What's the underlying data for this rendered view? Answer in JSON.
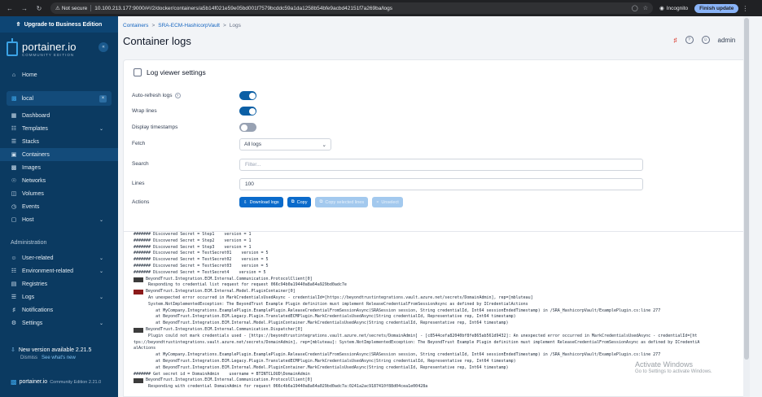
{
  "browser": {
    "security": "Not secure",
    "url": "10.100.213.177:9000/#!/2/docker/containers/a5b14f021e59e05bd001f7579bcddc59a1da1258b54bfe9acbd42151f7a269ba/logs",
    "incognito": "Incognito",
    "finish_update": "Finish update"
  },
  "sidebar": {
    "upgrade": "Upgrade to Business Edition",
    "logo_main": "portainer.io",
    "logo_sub": "COMMUNITY EDITION",
    "home": "Home",
    "env_name": "local",
    "env_items": [
      "Dashboard",
      "Templates",
      "Stacks",
      "Containers",
      "Images",
      "Networks",
      "Volumes",
      "Events",
      "Host"
    ],
    "admin_title": "Administration",
    "admin_items": [
      "User-related",
      "Environment-related",
      "Registries",
      "Logs",
      "Notifications",
      "Settings"
    ],
    "new_version": "New version available 2.21.5",
    "dismiss": "Dismiss",
    "see_whats_new": "See what's new",
    "footer_brand": "portainer.io",
    "footer_edition": "Community Edition 2.21.0"
  },
  "main": {
    "breadcrumb": [
      "Containers",
      "SRA-ECM-HashicorpVault",
      "Logs"
    ],
    "title": "Container logs",
    "user": "admin"
  },
  "settings": {
    "title": "Log viewer settings",
    "auto_refresh_label": "Auto-refresh logs",
    "wrap_lines_label": "Wrap lines",
    "display_timestamps_label": "Display timestamps",
    "fetch_label": "Fetch",
    "fetch_value": "All logs",
    "search_label": "Search",
    "search_placeholder": "Filter...",
    "lines_label": "Lines",
    "lines_value": "100",
    "actions_label": "Actions",
    "download_btn": "Download logs",
    "copy_btn": "Copy",
    "copy_selected_btn": "Copy selected lines",
    "unselect_btn": "Unselect"
  },
  "logs": [
    {
      "tag": "",
      "text": "####### Discovered Secret = Step1    version = 1"
    },
    {
      "tag": "",
      "text": "####### Discovered Secret = Step2    version = 1"
    },
    {
      "tag": "",
      "text": "####### Discovered Secret = Step3    version = 1"
    },
    {
      "tag": "",
      "text": "####### Discovered Secret = TestSecret01    version = 5"
    },
    {
      "tag": "",
      "text": "####### Discovered Secret = TestSecret02    version = 5"
    },
    {
      "tag": "",
      "text": "####### Discovered Secret = TestSecret03    version = 5"
    },
    {
      "tag": "",
      "text": "####### Discovered Secret = TestSecret4    version = 5"
    },
    {
      "tag": "fatal",
      "text": "BeyondTrust.Integration.ECM.Internal.Communication.ProtocolClient[0]"
    },
    {
      "tag": "",
      "text": "      Responding to credential list request for request 066c94b0a19440a8a64a929bd0adc7e"
    },
    {
      "tag": "err",
      "text": "BeyondTrust.Integration.ECM.Internal.Model.PluginContainer[0]"
    },
    {
      "tag": "",
      "text": "      An unexpected error occurred in MarkCredentialsUsedAsync - credentialId=[https://beyondtrustintegrations.vault.azure.net/secrets/DomainAdmin], rep=[mbluteau]"
    },
    {
      "tag": "",
      "text": "      System.NotImplementedException: The BeyondTrust Example Plugin definition must implement ReleaseCredentialFromSessionAsync as defined by ICredentialActions"
    },
    {
      "tag": "",
      "text": "         at MyCompany.Integrations.ExamplePlugin.ExamplePlugin.ReleaseCredentialFromSessionAsync(SRASession session, String credentialId, Int64 sessionEndedTimestamp) in /SRA_HashicorpVault/ExamplePlugin.cs:line 277"
    },
    {
      "tag": "",
      "text": "         at BeyondTrust.Integration.ECM.Legacy.Plugin.TranslatedECMPlugin.MarkCredentialsUsedAsync(String credentialId, Representative rep, Int64 timestamp)"
    },
    {
      "tag": "",
      "text": "         at BeyondTrust.Integration.ECM.Internal.Model.PluginContainer.MarkCredentialsUsedAsync(String credentialId, Representative rep, Int64 timestamp)"
    },
    {
      "tag": "fatal",
      "text": "BeyondTrust.Integration.ECM.Internal.Communication.Dispatcher[0]"
    },
    {
      "tag": "",
      "text": "      Plugin could not mark credentials used - [https://beyondtrustintegrations.vault.azure.net/secrets/DomainAdmin] - [c8544cefa82040bf8fe865ab561d9432]: An unexpected error occurred in MarkCredentialsUsedAsync - credentialId=[ht"
    },
    {
      "tag": "",
      "text": "tps://beyondtrustintegrations.vault.azure.net/secrets/DomainAdmin], rep=[mbluteau]: System.NotImplementedException: The BeyondTrust Example Plugin definition must implement ReleaseCredentialFromSessionAsync as defined by ICredentiA"
    },
    {
      "tag": "",
      "text": "alActions"
    },
    {
      "tag": "",
      "text": "         at MyCompany.Integrations.ExamplePlugin.ExamplePlugin.ReleaseCredentialFromSessionAsync(SRASession session, String credentialId, Int64 sessionEndedTimestamp) in /SRA_HashicorpVault/ExamplePlugin.cs:line 277"
    },
    {
      "tag": "",
      "text": "         at BeyondTrust.Integration.ECM.Legacy.Plugin.TranslatedECMPlugin.MarkCredentialsUsedAsync(String credentialId, Representative rep, Int64 timestamp)"
    },
    {
      "tag": "",
      "text": "         at BeyondTrust.Integration.ECM.Internal.Model.PluginContainer.MarkCredentialsUsedAsync(String credentialId, Representative rep, Int64 timestamp)"
    },
    {
      "tag": "",
      "text": "####### Get secret id = DomainAdmin    username = BTINTCLOUD\\DomainAdmin"
    },
    {
      "tag": "fatal",
      "text": "BeyondTrust.Integration.ECM.Internal.Communication.ProtocolClient[0]"
    },
    {
      "tag": "",
      "text": "      Responding with credential DomainAdmin for request 066c4b6a19440a8a64a029bd0adc7a:0241a2ac9187410f88d04cea1e00428a"
    }
  ],
  "watermark": {
    "title": "Activate Windows",
    "subtitle": "Go to Settings to activate Windows."
  }
}
